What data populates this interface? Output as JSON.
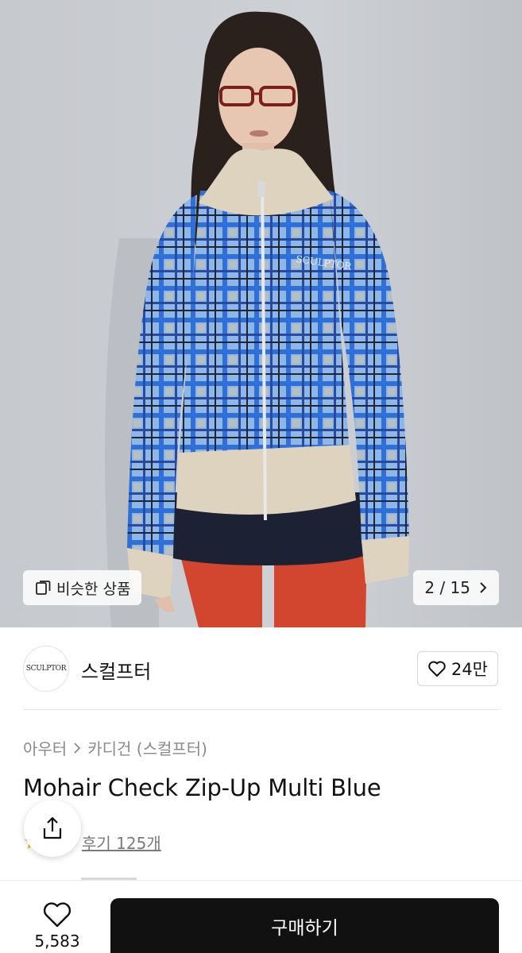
{
  "gallery": {
    "similar_label": "비슷한 상품",
    "counter": "2 / 15",
    "icons": {
      "similar": "copy-icon",
      "next": "chevron-right-icon"
    }
  },
  "brand": {
    "logo_text": "SCULPTOR",
    "name": "스컬프터",
    "likes": "24만"
  },
  "product": {
    "breadcrumb": [
      "아우터",
      "카디건 (스컬프터)"
    ],
    "title": "Mohair Check Zip-Up Multi Blue",
    "reviews_label": "후기 125개"
  },
  "bottom_bar": {
    "wish_count": "5,583",
    "buy_label": "구매하기"
  },
  "colors": {
    "check_blue": "#2f6fd6",
    "light_blue": "#8fb7e6",
    "cream": "#ddd3bf",
    "tights_red": "#d2452f",
    "buy_button": "#111111",
    "star": "#f2b01e"
  }
}
